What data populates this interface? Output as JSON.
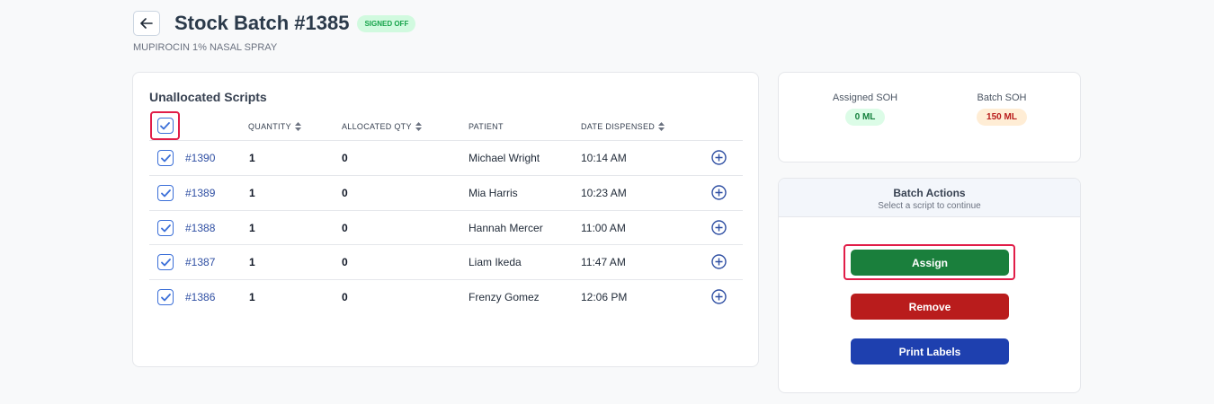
{
  "header": {
    "title": "Stock Batch #1385",
    "status": "SIGNED OFF",
    "subtitle": "MUPIROCIN 1% NASAL SPRAY"
  },
  "scripts": {
    "title": "Unallocated Scripts",
    "columns": {
      "quantity": "QUANTITY",
      "allocated": "ALLOCATED QTY",
      "patient": "PATIENT",
      "date": "DATE DISPENSED"
    },
    "rows": [
      {
        "id": "#1390",
        "quantity": "1",
        "allocated": "0",
        "patient": "Michael Wright",
        "date": "10:14 AM"
      },
      {
        "id": "#1389",
        "quantity": "1",
        "allocated": "0",
        "patient": "Mia Harris",
        "date": "10:23 AM"
      },
      {
        "id": "#1388",
        "quantity": "1",
        "allocated": "0",
        "patient": "Hannah Mercer",
        "date": "11:00 AM"
      },
      {
        "id": "#1387",
        "quantity": "1",
        "allocated": "0",
        "patient": "Liam Ikeda",
        "date": "11:47 AM"
      },
      {
        "id": "#1386",
        "quantity": "1",
        "allocated": "0",
        "patient": "Frenzy Gomez",
        "date": "12:06 PM"
      }
    ]
  },
  "soh": {
    "assigned_label": "Assigned SOH",
    "assigned_value": "0 ML",
    "batch_label": "Batch SOH",
    "batch_value": "150 ML"
  },
  "actions": {
    "title": "Batch Actions",
    "subtitle": "Select a script to continue",
    "assign": "Assign",
    "remove": "Remove",
    "print": "Print Labels"
  },
  "colors": {
    "assign": "#1a7f3c",
    "remove": "#b91c1c",
    "print": "#1e40af",
    "highlight": "#e11d48",
    "link": "#2f4fa3"
  },
  "icons": {
    "back": "arrow-left-icon",
    "check": "checkmark-icon",
    "sort": "sort-icon",
    "add": "plus-circle-icon"
  }
}
